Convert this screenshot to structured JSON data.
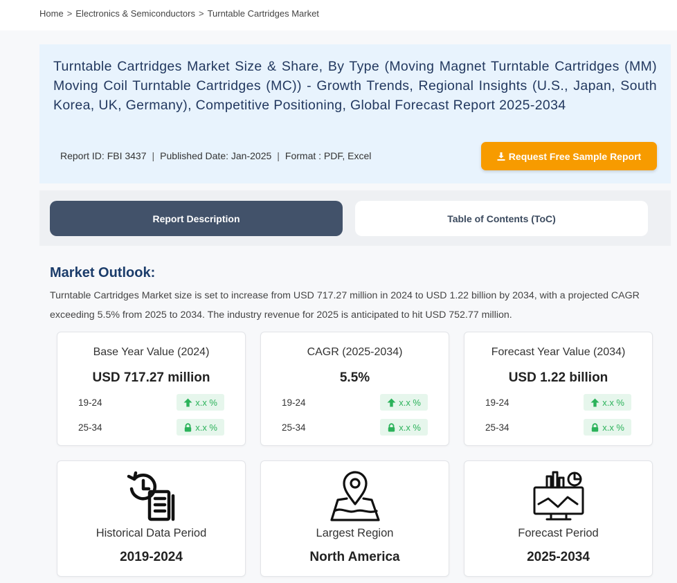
{
  "breadcrumb": {
    "items": [
      "Home",
      "Electronics & Semiconductors",
      "Turntable Cartridges Market"
    ],
    "separator": ">"
  },
  "hero": {
    "title": "Turntable Cartridges Market Size & Share, By Type (Moving Magnet Turntable Cartridges (MM) Moving Coil Turntable Cartridges (MC)) - Growth Trends, Regional Insights (U.S., Japan, South Korea, UK, Germany), Competitive Positioning, Global Forecast Report 2025-2034",
    "report_id": "Report ID: FBI 3437",
    "published": "Published Date: Jan-2025",
    "format": "Format : PDF, Excel",
    "meta_separator": "|",
    "sample_button": "Request Free Sample Report",
    "sample_icon": "download-icon"
  },
  "tabs": [
    {
      "label": "Report Description",
      "active": true
    },
    {
      "label": "Table of Contents (ToC)",
      "active": false
    }
  ],
  "outlook": {
    "title": "Market Outlook:",
    "text": "Turntable Cartridges Market size is set to increase from USD 717.27 million in 2024 to USD 1.22 billion by 2034, with a projected CAGR exceeding 5.5% from 2025 to 2034. The industry revenue for 2025 is anticipated to hit USD 752.77 million."
  },
  "stats": [
    {
      "label": "Base Year Value (2024)",
      "value": "USD 717.27 million",
      "rows": [
        {
          "period": "19-24",
          "badge": "x.x %",
          "icon": "arrow-up-icon"
        },
        {
          "period": "25-34",
          "badge": "x.x %",
          "icon": "lock-icon"
        }
      ]
    },
    {
      "label": "CAGR (2025-2034)",
      "value": "5.5%",
      "rows": [
        {
          "period": "19-24",
          "badge": "x.x %",
          "icon": "arrow-up-icon"
        },
        {
          "period": "25-34",
          "badge": "x.x %",
          "icon": "lock-icon"
        }
      ]
    },
    {
      "label": "Forecast Year Value (2034)",
      "value": "USD 1.22 billion",
      "rows": [
        {
          "period": "19-24",
          "badge": "x.x %",
          "icon": "arrow-up-icon"
        },
        {
          "period": "25-34",
          "badge": "x.x %",
          "icon": "lock-icon"
        }
      ]
    }
  ],
  "info": [
    {
      "label": "Historical Data Period",
      "value": "2019-2024",
      "icon": "history-icon"
    },
    {
      "label": "Largest Region",
      "value": "North America",
      "icon": "map-pin-icon"
    },
    {
      "label": "Forecast Period",
      "value": "2025-2034",
      "icon": "forecast-chart-icon"
    }
  ],
  "colors": {
    "accent": "#f79b00",
    "title_blue": "#22385f",
    "tab_active": "#42526a",
    "hero_bg": "#e8f3fd",
    "positive": "#2bb25a",
    "positive_bg": "#e6f6ec"
  }
}
